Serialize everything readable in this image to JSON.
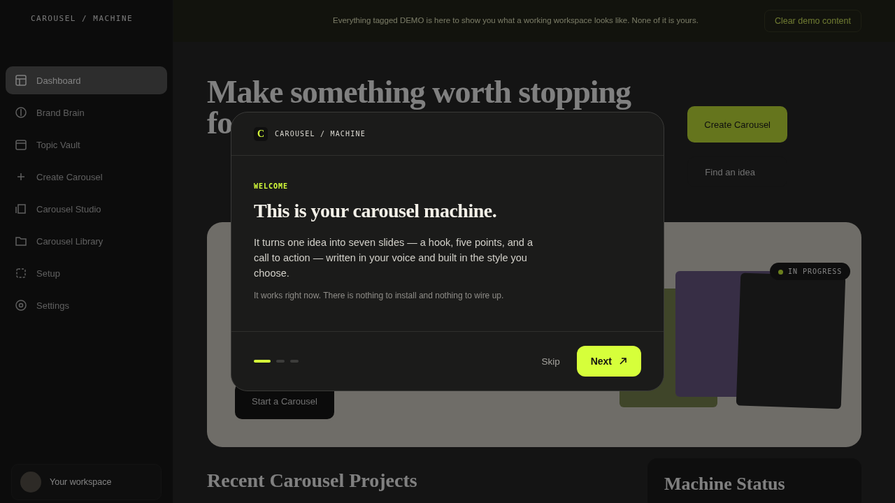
{
  "sidebar": {
    "brand": "CAROUSEL / MACHINE",
    "items": [
      {
        "label": "Dashboard",
        "selected": true
      },
      {
        "label": "Brand Brain",
        "selected": false
      },
      {
        "label": "Topic Vault",
        "selected": false
      },
      {
        "label": "Create Carousel",
        "selected": false
      },
      {
        "label": "Carousel Studio",
        "selected": false
      },
      {
        "label": "Carousel Library",
        "selected": false
      },
      {
        "label": "Setup",
        "selected": false
      },
      {
        "label": "Settings",
        "selected": false
      }
    ],
    "workspace": {
      "name": "Your workspace"
    }
  },
  "banner": {
    "text": "Everything tagged DEMO is here to show you what a working workspace looks like. None of it is yours.",
    "button": "Clear demo content"
  },
  "header": {
    "title_lines": [
      "Make something worth stopping",
      "fo"
    ],
    "primary_button": "Create Carousel",
    "secondary_button": "Find an idea"
  },
  "hero": {
    "button": "Start a Carousel",
    "badge": "IN PROGRESS"
  },
  "sections": {
    "recent_title": "Recent Carousel Projects",
    "status_title": "Machine Status"
  },
  "modal": {
    "logo": "C",
    "brand": "CAROUSEL / MACHINE",
    "eyebrow": "WELCOME",
    "title": "This is your carousel machine.",
    "body": "It turns one idea into seven slides — a hook, five points, and a call to action — written in your voice and built in the style you choose.",
    "note": "It works right now. There is nothing to install and nothing to wire up.",
    "steps": [
      {
        "selected": true
      },
      {
        "selected": false
      },
      {
        "selected": false
      }
    ],
    "skip": "Skip",
    "next": "Next"
  }
}
